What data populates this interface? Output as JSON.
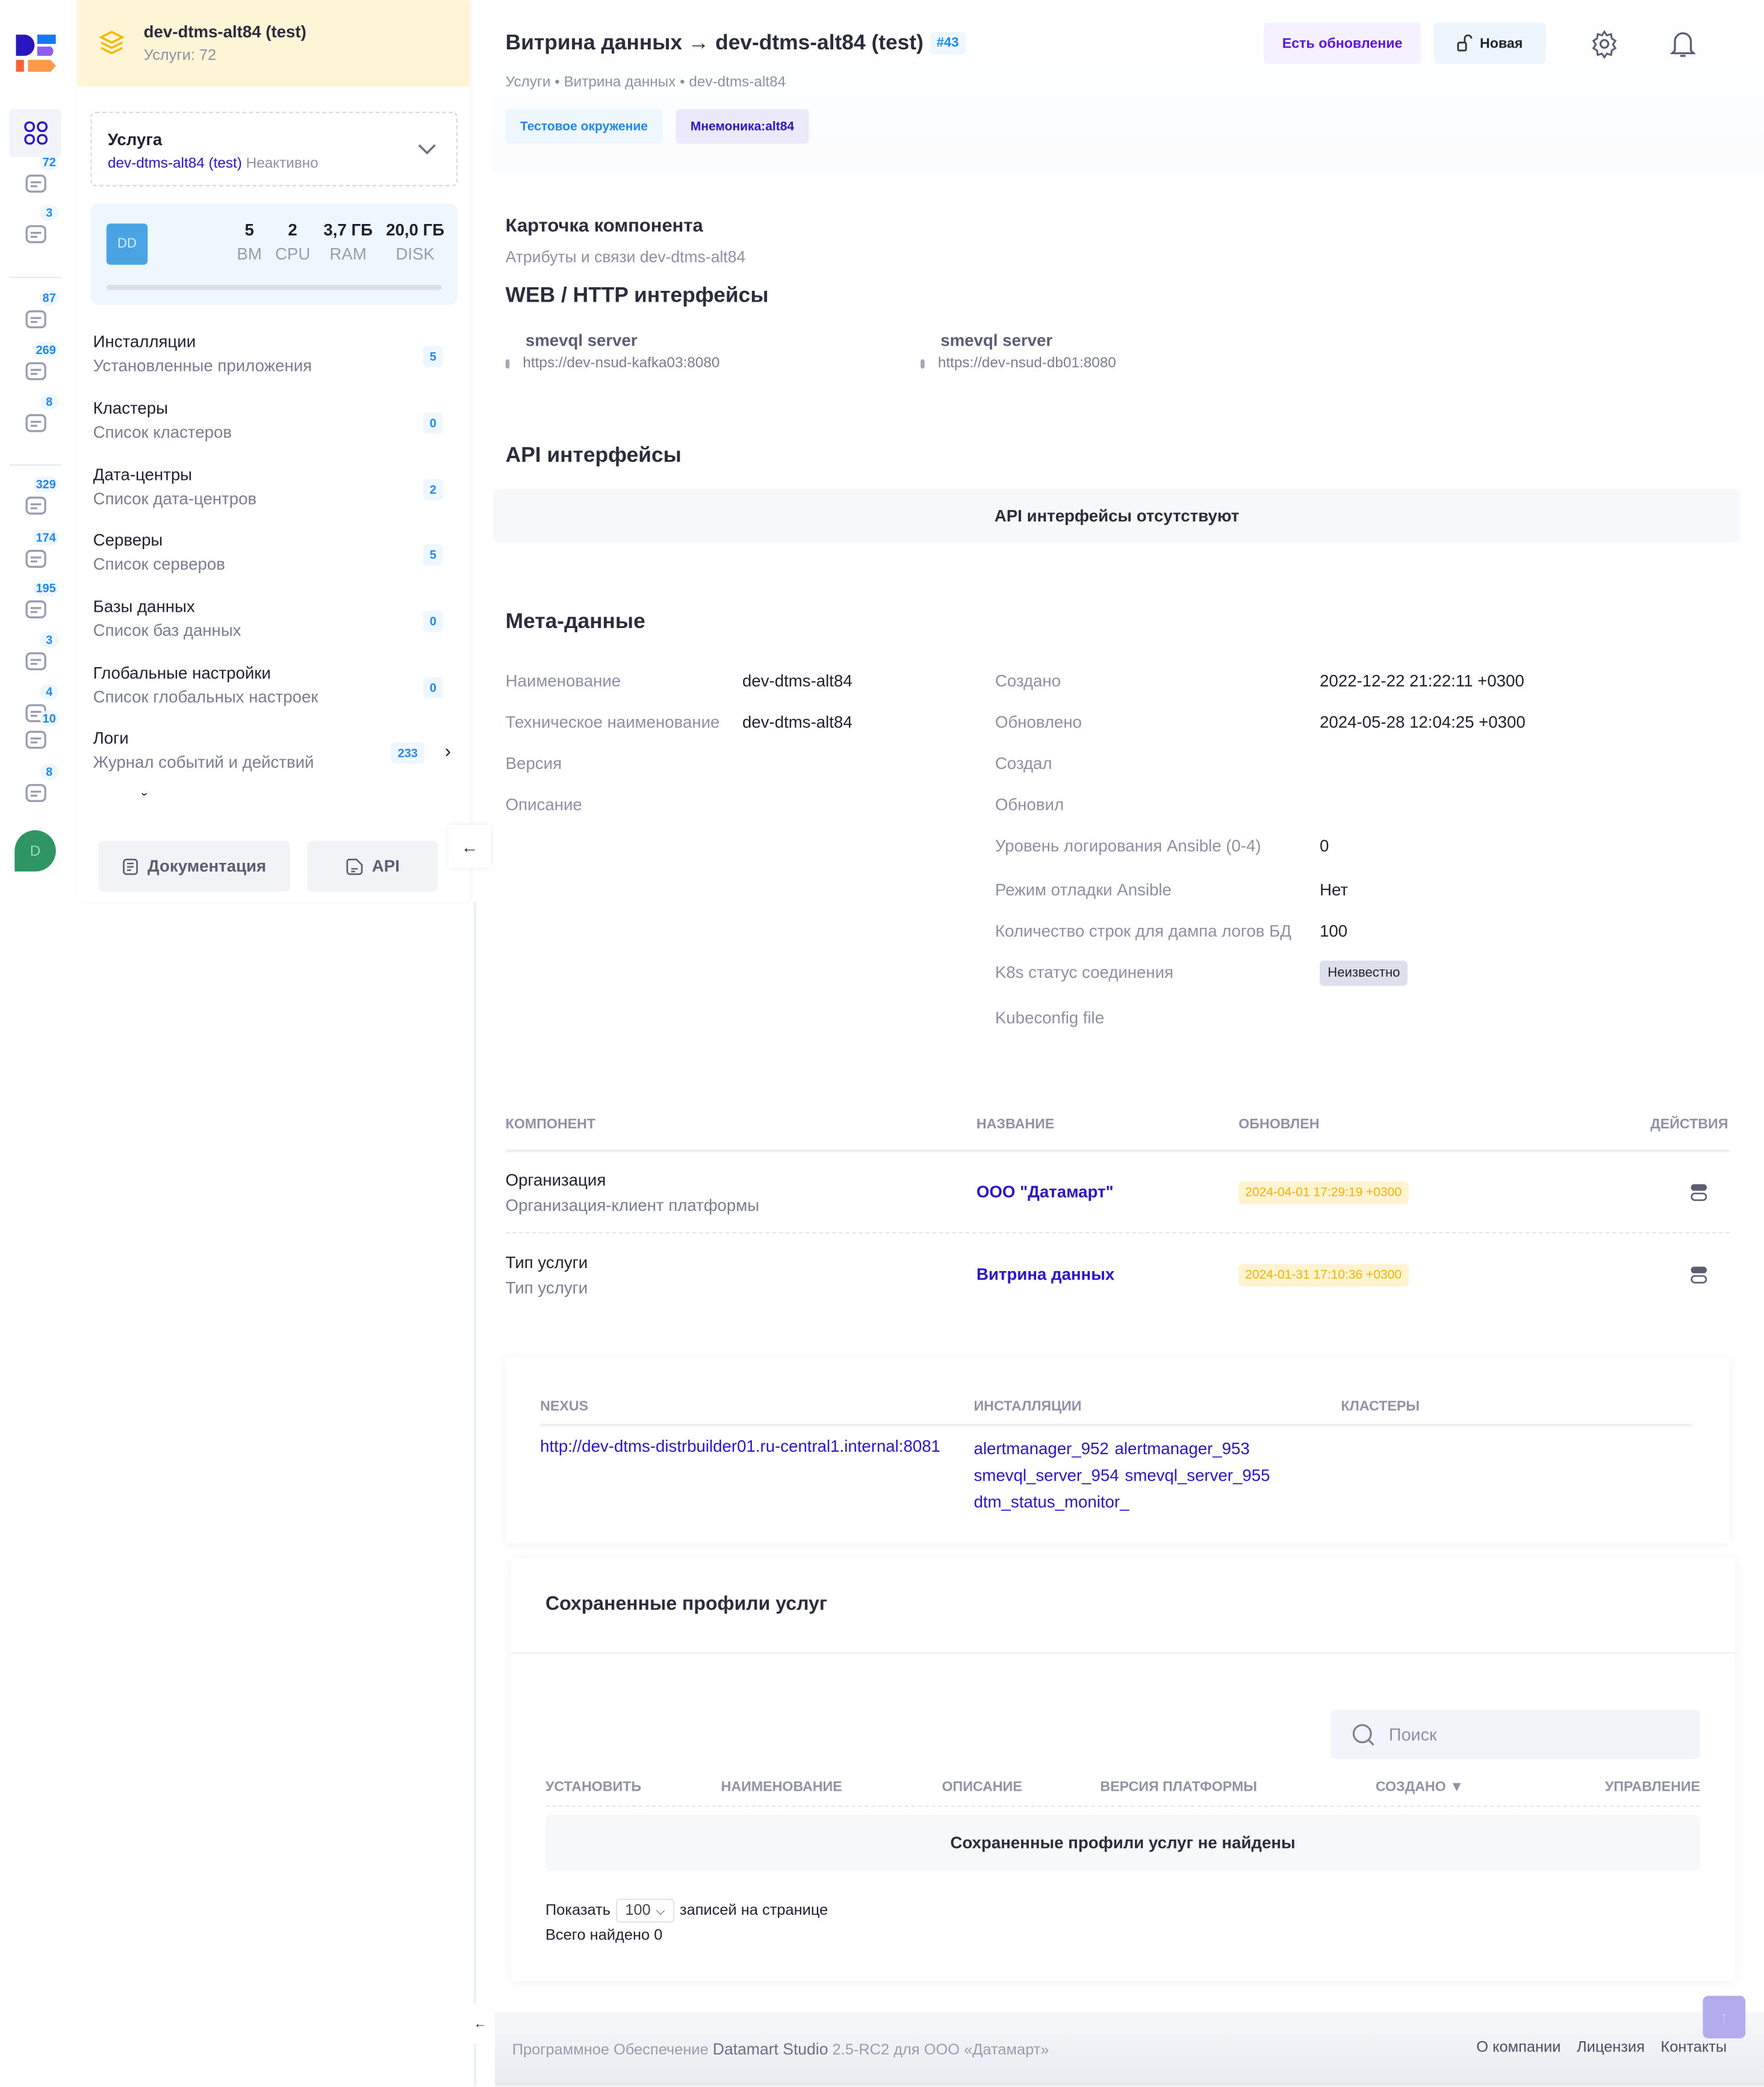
{
  "rail": {
    "items": [
      {
        "icon": "dashboard-grid-icon",
        "badge": ""
      },
      {
        "icon": "services-list-icon",
        "badge": "72"
      },
      {
        "icon": "database-icon",
        "badge": "3"
      },
      {
        "icon": "server-stack-icon",
        "badge": "87"
      },
      {
        "icon": "terminal-window-icon",
        "badge": "269"
      },
      {
        "icon": "chip-icon",
        "badge": "8"
      },
      {
        "icon": "hand-package-icon",
        "badge": "329"
      },
      {
        "icon": "cart-box-icon",
        "badge": "174"
      },
      {
        "icon": "hierarchy-icon",
        "badge": "195"
      },
      {
        "icon": "layout-blocks-icon",
        "badge": "3"
      },
      {
        "icon": "window-stack-icon",
        "badge": "4"
      },
      {
        "icon": "checklist-icon",
        "badge": "10"
      },
      {
        "icon": "shield-check-icon",
        "badge": "8"
      }
    ],
    "avatar": "D"
  },
  "sidebar": {
    "header_title": "dev-dtms-alt84 (test)",
    "header_sub": "Услуги: 72",
    "service_label": "Услуга",
    "service_name": "dev-dtms-alt84 (test)",
    "service_status": "Неактивно",
    "resources": {
      "avatar": "DD",
      "items": [
        {
          "v": "5",
          "l": "ВМ"
        },
        {
          "v": "2",
          "l": "CPU"
        },
        {
          "v": "3,7 ГБ",
          "l": "RAM"
        },
        {
          "v": "20,0 ГБ",
          "l": "DISK"
        }
      ]
    },
    "items": [
      {
        "title": "Инсталляции",
        "sub": "Установленные приложения",
        "count": "5"
      },
      {
        "title": "Кластеры",
        "sub": "Список кластеров",
        "count": "0"
      },
      {
        "title": "Дата-центры",
        "sub": "Список дата-центров",
        "count": "2"
      },
      {
        "title": "Серверы",
        "sub": "Список серверов",
        "count": "5"
      },
      {
        "title": "Базы данных",
        "sub": "Список баз данных",
        "count": "0"
      },
      {
        "title": "Глобальные настройки",
        "sub": "Список глобальных настроек",
        "count": "0"
      },
      {
        "title": "Логи",
        "sub": "Журнал событий и действий",
        "count": "233"
      }
    ],
    "docs_button": "Документация",
    "api_button": "API"
  },
  "header": {
    "title": "Витрина данных → dev-dtms-alt84 (test)",
    "id_badge": "#43",
    "update_button": "Есть обновление",
    "new_button": "Новая",
    "breadcrumb": [
      "Услуги",
      "Витрина данных",
      "dev-dtms-alt84"
    ],
    "tags": [
      "Тестовое окружение",
      "Мнемоника:alt84"
    ]
  },
  "card": {
    "title": "Карточка компонента",
    "subtitle": "Атрибуты и связи dev-dtms-alt84",
    "web_title": "WEB / HTTP интерфейсы",
    "web": [
      {
        "name": "smevql server",
        "url": "https://dev-nsud-kafka03:8080"
      },
      {
        "name": "smevql server",
        "url": "https://dev-nsud-db01:8080"
      }
    ],
    "api_title": "API интерфейсы",
    "api_empty": "API интерфейсы отсутствуют"
  },
  "meta": {
    "title": "Мета-данные",
    "left": [
      {
        "label": "Наименование",
        "value": "dev-dtms-alt84"
      },
      {
        "label": "Техническое наименование",
        "value": "dev-dtms-alt84"
      },
      {
        "label": "Версия",
        "value": ""
      },
      {
        "label": "Описание",
        "value": ""
      }
    ],
    "right": [
      {
        "label": "Создано",
        "value": "2022-12-22 21:22:11 +0300"
      },
      {
        "label": "Обновлено",
        "value": "2024-05-28 12:04:25 +0300"
      },
      {
        "label": "Создал",
        "value": ""
      },
      {
        "label": "Обновил",
        "value": ""
      },
      {
        "label": "Уровень логирования Ansible (0-4)",
        "value": "0"
      },
      {
        "label": "Режим отладки Ansible",
        "value": "Нет"
      },
      {
        "label": "Количество строк для дампа логов БД",
        "value": "100"
      },
      {
        "label": "K8s статус соединения",
        "value": "Неизвестно"
      },
      {
        "label": "Kubeconfig file",
        "value": ""
      }
    ]
  },
  "components": {
    "columns": [
      "Компонент",
      "Название",
      "Обновлен",
      "Действия"
    ],
    "rows": [
      {
        "title": "Организация",
        "sub": "Организация-клиент платформы",
        "name": "ООО \"Датамарт\"",
        "updated": "2024-04-01 17:29:19 +0300"
      },
      {
        "title": "Тип услуги",
        "sub": "Тип услуги",
        "name": "Витрина данных",
        "updated": "2024-01-31 17:10:36 +0300"
      }
    ]
  },
  "nexus": {
    "columns": [
      "Nexus",
      "Инсталляции",
      "Кластеры"
    ],
    "url": "http://dev-dtms-distrbuilder01.ru-central1.internal:8081",
    "installs": [
      "alertmanager_952",
      "alertmanager_953",
      "smevql_server_954",
      "smevql_server_955",
      "dtm_status_monitor_"
    ]
  },
  "profiles": {
    "title": "Сохраненные профили услуг",
    "search_placeholder": "Поиск",
    "columns": [
      "Установить",
      "Наименование",
      "Описание",
      "Версия платформы",
      "Создано",
      "Управление"
    ],
    "empty": "Сохраненные профили услуг не найдены",
    "show_label": "Показать",
    "page_size": "100",
    "per_page_label": "записей на странице",
    "total": "Всего найдено 0"
  },
  "footer": {
    "prefix": "Программное Обеспечение",
    "product": "Datamart Studio",
    "version": "2.5-RC2 для ООО «Датамарт»",
    "links": [
      "О компании",
      "Лицензия",
      "Контакты"
    ]
  },
  "colors": {
    "accent": "#2a16c8",
    "badge": "#1e88f0",
    "header_bg": "#fdf5d6",
    "date_badge": "#f2b100"
  }
}
